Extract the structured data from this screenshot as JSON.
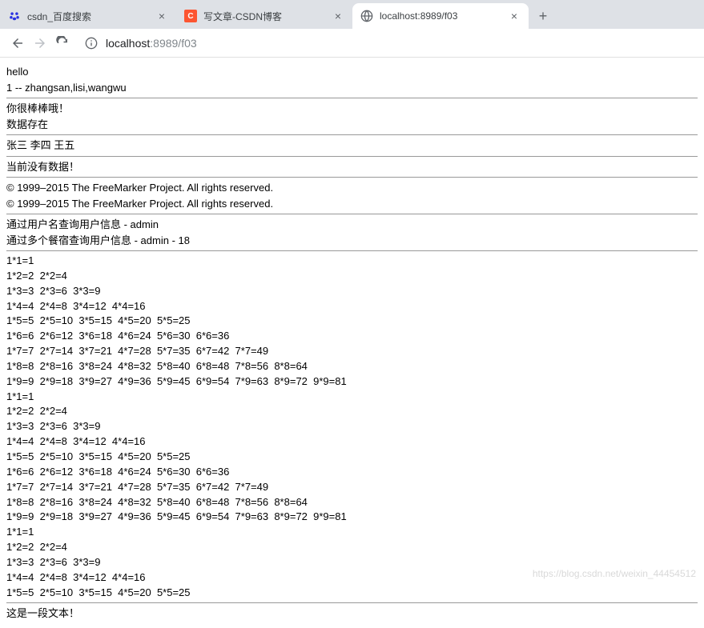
{
  "tabs": [
    {
      "title": "csdn_百度搜索",
      "favicon": "baidu"
    },
    {
      "title": "写文章-CSDN博客",
      "favicon": "csdn"
    },
    {
      "title": "localhost:8989/f03",
      "favicon": "globe",
      "active": true
    }
  ],
  "url": {
    "host": "localhost",
    "portpath": ":8989/f03"
  },
  "content": {
    "hello": "hello",
    "line1": "1 -- zhangsan,lisi,wangwu",
    "praise": "你很棒棒哦！",
    "dataExist": "数据存在",
    "names": "张三 李四 王五",
    "noData": "当前没有数据！",
    "copy1": "© 1999–2015 The FreeMarker Project. All rights reserved.",
    "copy2": "© 1999–2015 The FreeMarker Project. All rights reserved.",
    "query1": "通过用户名查询用户信息 - admin",
    "query2": "通过多个餐宿查询用户信息 - admin - 18",
    "mult": [
      "1*1=1",
      "1*2=2  2*2=4",
      "1*3=3  2*3=6  3*3=9",
      "1*4=4  2*4=8  3*4=12  4*4=16",
      "1*5=5  2*5=10  3*5=15  4*5=20  5*5=25",
      "1*6=6  2*6=12  3*6=18  4*6=24  5*6=30  6*6=36",
      "1*7=7  2*7=14  3*7=21  4*7=28  5*7=35  6*7=42  7*7=49",
      "1*8=8  2*8=16  3*8=24  4*8=32  5*8=40  6*8=48  7*8=56  8*8=64",
      "1*9=9  2*9=18  3*9=27  4*9=36  5*9=45  6*9=54  7*9=63  8*9=72  9*9=81",
      "1*1=1",
      "1*2=2  2*2=4",
      "1*3=3  2*3=6  3*3=9",
      "1*4=4  2*4=8  3*4=12  4*4=16",
      "1*5=5  2*5=10  3*5=15  4*5=20  5*5=25",
      "1*6=6  2*6=12  3*6=18  4*6=24  5*6=30  6*6=36",
      "1*7=7  2*7=14  3*7=21  4*7=28  5*7=35  6*7=42  7*7=49",
      "1*8=8  2*8=16  3*8=24  4*8=32  5*8=40  6*8=48  7*8=56  8*8=64",
      "1*9=9  2*9=18  3*9=27  4*9=36  5*9=45  6*9=54  7*9=63  8*9=72  9*9=81",
      "1*1=1",
      "1*2=2  2*2=4",
      "1*3=3  2*3=6  3*3=9",
      "1*4=4  2*4=8  3*4=12  4*4=16",
      "1*5=5  2*5=10  3*5=15  4*5=20  5*5=25"
    ],
    "footerText": "这是一段文本！"
  },
  "watermark": "https://blog.csdn.net/weixin_44454512"
}
